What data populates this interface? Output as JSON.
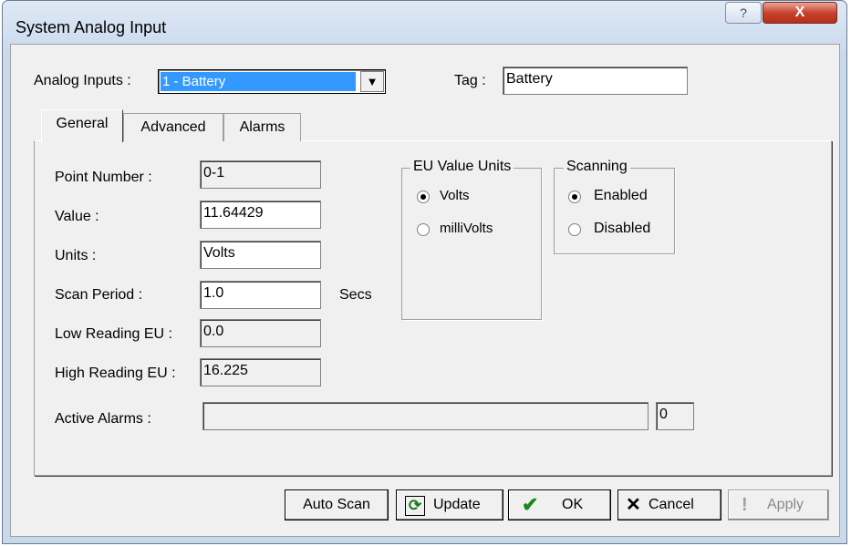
{
  "window": {
    "title": "System Analog Input",
    "help_glyph": "?",
    "close_glyph": "X"
  },
  "header": {
    "analog_inputs_label": "Analog Inputs :",
    "analog_inputs_value": "1 - Battery",
    "tag_label": "Tag :",
    "tag_value": "Battery"
  },
  "tabs": [
    {
      "label": "General"
    },
    {
      "label": "Advanced"
    },
    {
      "label": "Alarms"
    }
  ],
  "general": {
    "point_number_label": "Point Number :",
    "point_number_value": "0-1",
    "value_label": "Value :",
    "value_value": "11.64429",
    "units_label": "Units :",
    "units_value": "Volts",
    "scan_period_label": "Scan Period :",
    "scan_period_value": "1.0",
    "scan_period_units": "Secs",
    "low_reading_label": "Low Reading EU :",
    "low_reading_value": "0.0",
    "high_reading_label": "High Reading EU :",
    "high_reading_value": "16.225",
    "active_alarms_label": "Active Alarms :",
    "active_alarms_value": "",
    "active_alarms_count": "0"
  },
  "eu_units": {
    "title": "EU Value Units",
    "options": [
      {
        "label": "Volts",
        "selected": true
      },
      {
        "label": "milliVolts",
        "selected": false
      }
    ]
  },
  "scanning": {
    "title": "Scanning",
    "options": [
      {
        "label": "Enabled",
        "selected": true
      },
      {
        "label": "Disabled",
        "selected": false
      }
    ]
  },
  "buttons": {
    "auto_scan": "Auto Scan",
    "update": "Update",
    "ok": "OK",
    "cancel": "Cancel",
    "apply": "Apply"
  },
  "colors": {
    "selection": "#3399ff",
    "ok_check": "#1a8a1a",
    "cancel_x": "#000000"
  }
}
